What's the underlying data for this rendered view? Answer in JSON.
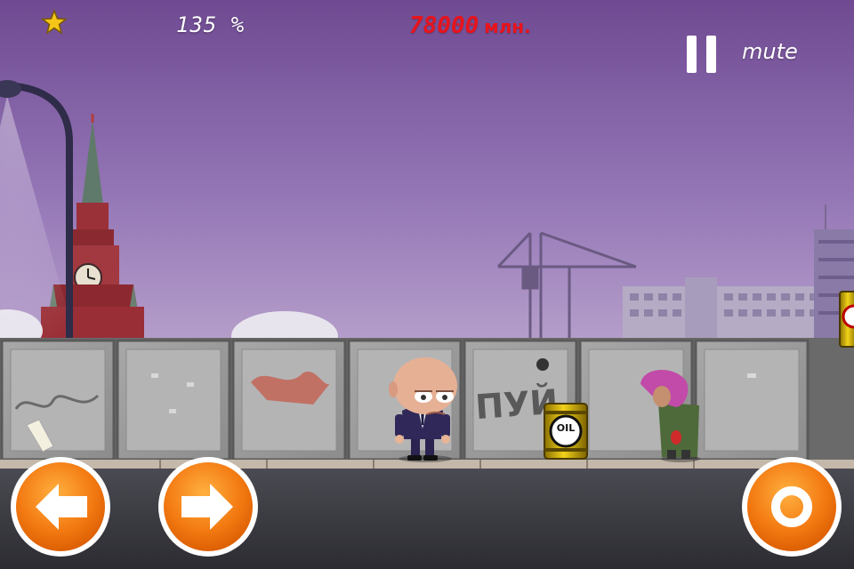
{
  "hud": {
    "percent": "135 %",
    "money_value": "78000",
    "money_unit": "млн.",
    "mute_label": "mute",
    "money_color": "#e8141c"
  },
  "scene": {
    "graffiti_text": "ПУЙ",
    "barrel_label": "OIL",
    "sky_color": "#8e6db0",
    "barrel_color": "#d4b400"
  },
  "controls": {
    "left": "arrow-left-icon",
    "right": "arrow-right-icon",
    "action": "ring-icon",
    "pause": "pause-icon",
    "button_color": "#f47a16"
  }
}
